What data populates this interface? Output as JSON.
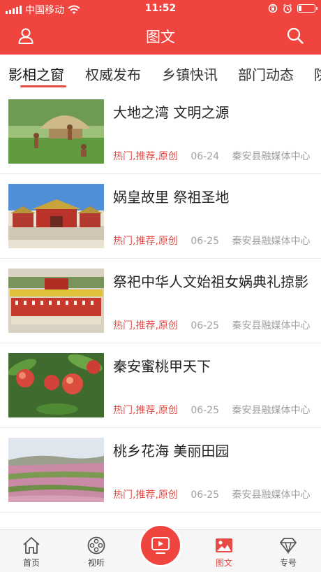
{
  "status_bar": {
    "carrier": "中国移动",
    "time": "11:52"
  },
  "header": {
    "title": "图文"
  },
  "tabs": [
    {
      "label": "影相之窗",
      "active": true
    },
    {
      "label": "权威发布",
      "active": false
    },
    {
      "label": "乡镇快讯",
      "active": false
    },
    {
      "label": "部门动态",
      "active": false
    },
    {
      "label": "院",
      "active": false
    }
  ],
  "articles": [
    {
      "title": "大地之湾 文明之源",
      "tags": "热门,推荐,原创",
      "date": "06-24",
      "source": "秦安县融媒体中心"
    },
    {
      "title": "娲皇故里 祭祖圣地",
      "tags": "热门,推荐,原创",
      "date": "06-25",
      "source": "秦安县融媒体中心"
    },
    {
      "title": "祭祀中华人文始祖女娲典礼掠影",
      "tags": "热门,推荐,原创",
      "date": "06-25",
      "source": "秦安县融媒体中心"
    },
    {
      "title": "秦安蜜桃甲天下",
      "tags": "热门,推荐,原创",
      "date": "06-25",
      "source": "秦安县融媒体中心"
    },
    {
      "title": "桃乡花海 美丽田园",
      "tags": "热门,推荐,原创",
      "date": "06-25",
      "source": "秦安县融媒体中心"
    }
  ],
  "bottom_nav": [
    {
      "label": "首页",
      "icon": "home-icon"
    },
    {
      "label": "视听",
      "icon": "film-reel-icon"
    },
    {
      "label": "图文",
      "icon": "image-icon",
      "active": true
    },
    {
      "label": "专号",
      "icon": "diamond-icon"
    }
  ],
  "colors": {
    "brand_red": "#f0453f",
    "tag_red": "#e84a45",
    "meta_gray": "#a0a0a0"
  }
}
